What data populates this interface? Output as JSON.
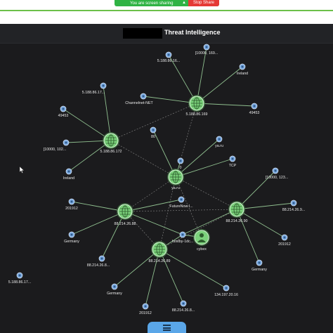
{
  "screen_share": {
    "message": "You are screen sharing",
    "stop_label": "Stop Share"
  },
  "header": {
    "title": "Threat Intelligence"
  },
  "colors": {
    "background": "#1b1b1d",
    "hub_fill": "#7bd17b",
    "leaf_fill": "#7aa8de",
    "edge": "#8fbf8f",
    "label": "#e8e8e8",
    "share_green": "#2fb344",
    "stop_red": "#e53935"
  },
  "graph": {
    "hubs": [
      {
        "id": "h1",
        "label": "5.188.86.169",
        "icon": "globe-icon"
      },
      {
        "id": "h2",
        "label": "5.188.86.172",
        "icon": "globe-icon"
      },
      {
        "id": "h3",
        "label": "ya.ru",
        "icon": "globe-icon"
      },
      {
        "id": "h4",
        "label": "88.214.26.88",
        "icon": "globe-icon"
      },
      {
        "id": "h5",
        "label": "88.214.26.90",
        "icon": "globe-icon"
      },
      {
        "id": "h6",
        "label": "88.214.26.89",
        "icon": "globe-icon"
      },
      {
        "id": "h7",
        "label": "cybex",
        "icon": "avatar-icon"
      }
    ],
    "leaves": [
      {
        "id": "l1",
        "label": "[10000, 169..."
      },
      {
        "id": "l2",
        "label": "5.188.86.16..."
      },
      {
        "id": "l3",
        "label": "Ireland"
      },
      {
        "id": "l4",
        "label": "Channelnet-NET"
      },
      {
        "id": "l5",
        "label": "49453"
      },
      {
        "id": "l6",
        "label": "5.188.86.17..."
      },
      {
        "id": "l7",
        "label": "49453"
      },
      {
        "id": "l8",
        "label": "80"
      },
      {
        "id": "l9",
        "label": "[10000, 102..."
      },
      {
        "id": "l10",
        "label": "Ireland"
      },
      {
        "id": "l11",
        "label": "ya.ru"
      },
      {
        "id": "l12",
        "label": "0"
      },
      {
        "id": "l13",
        "label": "TCP"
      },
      {
        "id": "l14",
        "label": "[10000, 123..."
      },
      {
        "id": "l15",
        "label": "201912"
      },
      {
        "id": "l16",
        "label": "FutureNow I..."
      },
      {
        "id": "l17",
        "label": "88.214.26.9..."
      },
      {
        "id": "l18",
        "label": "Germany"
      },
      {
        "id": "l19",
        "label": "hostby-1dc..."
      },
      {
        "id": "l20",
        "label": "201912"
      },
      {
        "id": "l21",
        "label": "88.214.26.8..."
      },
      {
        "id": "l22",
        "label": "Germany"
      },
      {
        "id": "l23",
        "label": "5.188.86.17..."
      },
      {
        "id": "l24",
        "label": "Germany"
      },
      {
        "id": "l25",
        "label": "134.197.20.16"
      },
      {
        "id": "l26",
        "label": "201912"
      },
      {
        "id": "l27",
        "label": "88.214.26.8..."
      }
    ]
  }
}
